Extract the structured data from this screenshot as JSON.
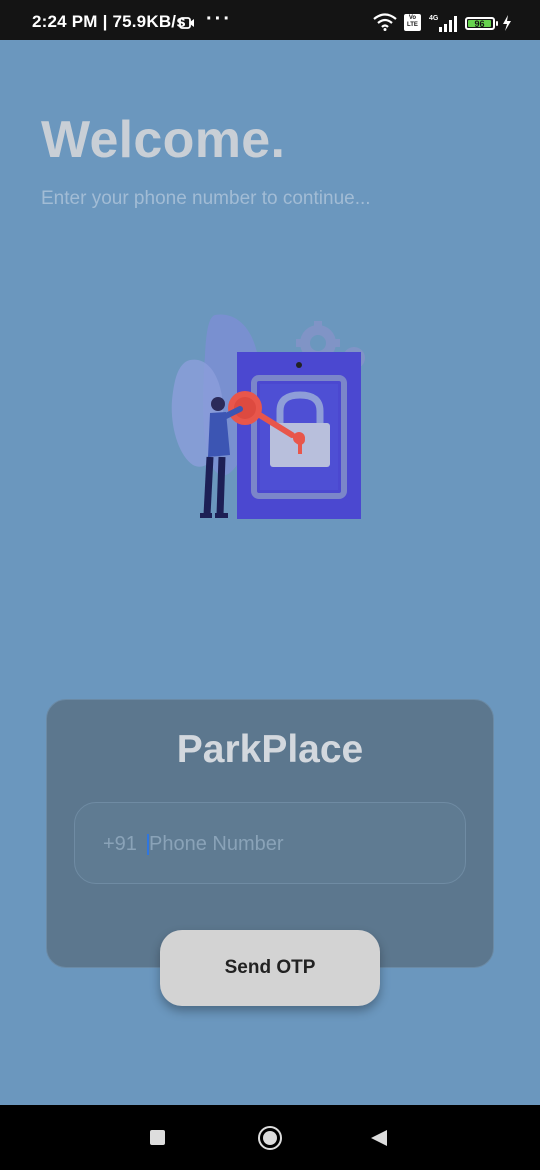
{
  "status_bar": {
    "time": "2:24 PM | 75.9KB/s",
    "volte": "Vo LTE",
    "network": "4G",
    "battery": "96",
    "battery_level": 0.96
  },
  "welcome": {
    "title": "Welcome.",
    "subtitle": "Enter your phone number to continue..."
  },
  "card": {
    "title": "ParkPlace",
    "phone_prefix": "+91",
    "phone_placeholder": "Phone Number",
    "phone_value": ""
  },
  "actions": {
    "send_otp_label": "Send OTP"
  },
  "colors": {
    "background": "#6b97be",
    "card": "#5c778e",
    "illustration_phone": "#4b48d0",
    "key": "#e8564b"
  },
  "icons": [
    "video-camera-icon",
    "more-dots-icon",
    "wifi-icon",
    "volte-icon",
    "signal-icon",
    "battery-icon",
    "charging-icon",
    "recents-icon",
    "home-icon",
    "back-icon"
  ]
}
